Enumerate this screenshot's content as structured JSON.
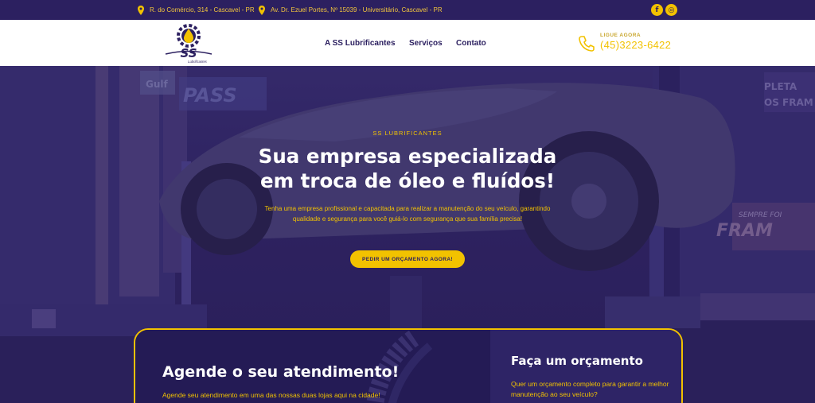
{
  "topbar": {
    "address_1": "R. do Comércio, 314 - Cascavel - PR",
    "address_2": "Av. Dr. Ezuel Portes, Nº 15039 - Universitário, Cascavel - PR",
    "facebook_glyph": "f",
    "instagram_glyph": "◎"
  },
  "header": {
    "logo_text": "SS",
    "logo_sub": "Lubrificantes",
    "nav": [
      "A SS Lubrificantes",
      "Serviços",
      "Contato"
    ],
    "phone_label": "LIGUE AGORA",
    "phone_number": "(45)3223-6422"
  },
  "hero": {
    "kicker": "SS LUBRIFICANTES",
    "headline_line1": "Sua empresa especializada",
    "headline_line2": "em troca de óleo e fluídos!",
    "lead": "Tenha uma empresa profissional e capacitada para realizar a manutenção do seu veículo, garantindo qualidade e segurança para você guiá-lo com segurança que sua família precisa!",
    "cta_label": "PEDIR UM ORÇAMENTO AGORA!",
    "bg_signs": [
      "Gulf",
      "PASS",
      "PLETA",
      "OS FRAM",
      "SEMPRE FOI",
      "FRAM"
    ]
  },
  "cards": {
    "schedule_title": "Agende o seu atendimento!",
    "schedule_text": "Agende seu atendimento em uma das nossas duas lojas aqui na cidade!",
    "quote_title": "Faça um orçamento",
    "quote_text": "Quer um orçamento completo para garantir a melhor manutenção ao seu veículo?"
  },
  "colors": {
    "brand_purple": "#2c2060",
    "accent_yellow": "#f2c200"
  }
}
